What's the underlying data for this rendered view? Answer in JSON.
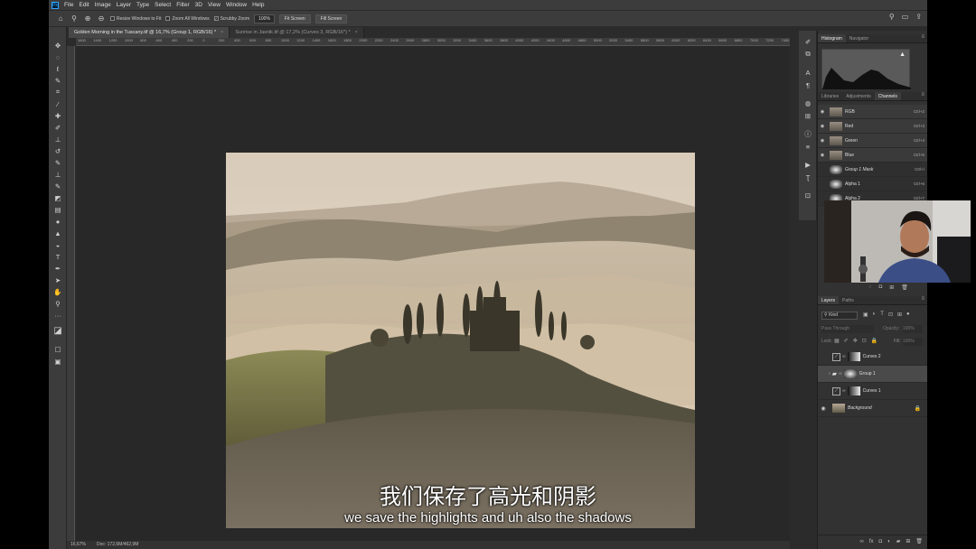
{
  "app": {
    "logo": "Ps"
  },
  "menu": [
    "File",
    "Edit",
    "Image",
    "Layer",
    "Type",
    "Select",
    "Filter",
    "3D",
    "View",
    "Window",
    "Help"
  ],
  "options": {
    "resize_windows_label": "Resize Windows to Fit",
    "zoom_all_windows_label": "Zoom All Windows",
    "scrubby_zoom_label": "Scrubby Zoom",
    "zoom_value": "100%",
    "fit_screen_label": "Fit Screen",
    "fill_screen_label": "Fill Screen"
  },
  "tabs": [
    {
      "label": "Golden Morning in the Tuscany.tif @ 16,7% (Group 1, RGB/16) *",
      "close": "×"
    },
    {
      "label": "Sunrise in Jasnik.tif @ 17,2% (Curves 3, RGB/16*) *",
      "close": "×"
    }
  ],
  "ruler_ticks": [
    "1600",
    "1400",
    "1200",
    "1000",
    "800",
    "600",
    "400",
    "200",
    "0",
    "200",
    "400",
    "600",
    "800",
    "1000",
    "1200",
    "1400",
    "1600",
    "1800",
    "2000",
    "2200",
    "2400",
    "2600",
    "2800",
    "3000",
    "3200",
    "3400",
    "3600",
    "3800",
    "4000",
    "4200",
    "4400",
    "4600",
    "4800",
    "5000",
    "5200",
    "5400",
    "5600",
    "5800",
    "6000",
    "6200",
    "6400",
    "6600",
    "6800",
    "7000",
    "7200",
    "7400"
  ],
  "status": {
    "zoom": "16,67%",
    "doc": "Doc: 172,6M/462,9M"
  },
  "panels": {
    "top_tabs": [
      "Histogram",
      "Navigator"
    ],
    "mid_tabs": [
      "Libraries",
      "Adjustments",
      "Channels"
    ],
    "channels": [
      {
        "name": "RGB",
        "shortcut": "Ctrl+2"
      },
      {
        "name": "Red",
        "shortcut": "Ctrl+3"
      },
      {
        "name": "Green",
        "shortcut": "Ctrl+4"
      },
      {
        "name": "Blue",
        "shortcut": "Ctrl+5"
      },
      {
        "name": "Group 1 Mask",
        "shortcut": "Ctrl+\\"
      },
      {
        "name": "Alpha 1",
        "shortcut": "Ctrl+6"
      },
      {
        "name": "Alpha 2",
        "shortcut": "Ctrl+7"
      }
    ],
    "layer_tabs": [
      "Layers",
      "Paths"
    ],
    "filter_kind": "Kind",
    "blend_mode": "Pass Through",
    "opacity_label": "Opacity:",
    "opacity_value": "100%",
    "lock_label": "Lock:",
    "fill_label": "Fill:",
    "fill_value": "100%",
    "layers": [
      {
        "name": "Curves 2"
      },
      {
        "name": "Group 1"
      },
      {
        "name": "Curves 1"
      },
      {
        "name": "Background"
      }
    ]
  },
  "subtitles": {
    "cn": "我们保存了高光和阴影",
    "en": "we save the highlights and uh also the shadows"
  }
}
